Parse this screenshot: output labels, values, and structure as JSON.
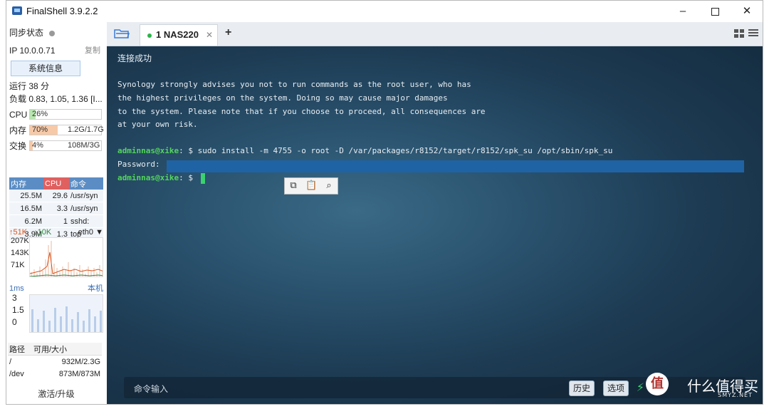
{
  "window": {
    "title": "FinalShell 3.9.2.2",
    "min": "–",
    "close": "✕"
  },
  "sidebar": {
    "sync_label": "同步状态",
    "ip": "IP 10.0.0.71",
    "copy": "复制",
    "sysinfo_button": "系统信息",
    "uptime": "运行 38 分",
    "load": "负载 0.83, 1.05, 1.36 [I...",
    "cpu": {
      "label": "CPU",
      "value": "26%",
      "percent": 26
    },
    "mem": {
      "label": "内存",
      "value": "70%",
      "detail": "1.2G/1.7G",
      "percent": 70
    },
    "swap": {
      "label": "交换",
      "value": "4%",
      "detail": "108M/3G",
      "percent": 4
    },
    "proc_headers": [
      "内存",
      "CPU",
      "命令"
    ],
    "processes": [
      {
        "mem": "25.5M",
        "cpu": "29.6",
        "cmd": "/usr/syn"
      },
      {
        "mem": "16.5M",
        "cpu": "3.3",
        "cmd": "/usr/syn"
      },
      {
        "mem": "6.2M",
        "cpu": "1",
        "cmd": "sshd:"
      },
      {
        "mem": "3.9M",
        "cpu": "1.3",
        "cmd": "top"
      }
    ],
    "net": {
      "up": "↑51K",
      "down": "↓10K",
      "iface": "eth0",
      "axis": [
        "207K",
        "143K",
        "71K"
      ]
    },
    "ping": {
      "label": "1ms",
      "host": "本机",
      "axis": [
        "3",
        "1.5",
        "0"
      ]
    },
    "disk_headers": [
      "路径",
      "可用/大小"
    ],
    "disks": [
      {
        "path": "/",
        "size": "932M/2.3G"
      },
      {
        "path": "/dev",
        "size": "873M/873M"
      }
    ],
    "upgrade": "激活/升级"
  },
  "tabs": [
    {
      "label": "1 NAS220",
      "close": "✕"
    }
  ],
  "add_tab": "+",
  "terminal": {
    "lines": [
      "连接成功",
      "",
      "Synology strongly advises you not to run commands as the root user, who has",
      "the highest privileges on the system. Doing so may cause major damages",
      "to the system. Please note that if you choose to proceed, all consequences are",
      "at your own risk.",
      ""
    ],
    "prompt_user": "adminnas@xike",
    "prompt_suffix": ": $ ",
    "command": "sudo install -m 4755 -o root -D /var/packages/r8152/target/r8152/spk_su /opt/sbin/spk_su",
    "password_label": "Password:",
    "cmd_placeholder": "命令输入",
    "history_button": "历史",
    "options_button": "选项"
  },
  "watermark": {
    "logo": "值",
    "text": "什么值得买",
    "sub": "SMYZ.NET"
  },
  "colors": {
    "prompt": "#52d65a",
    "selection": "#1f63a5",
    "cpu_fill": "#b9e6b0",
    "mem_fill": "#f6c9a8"
  }
}
